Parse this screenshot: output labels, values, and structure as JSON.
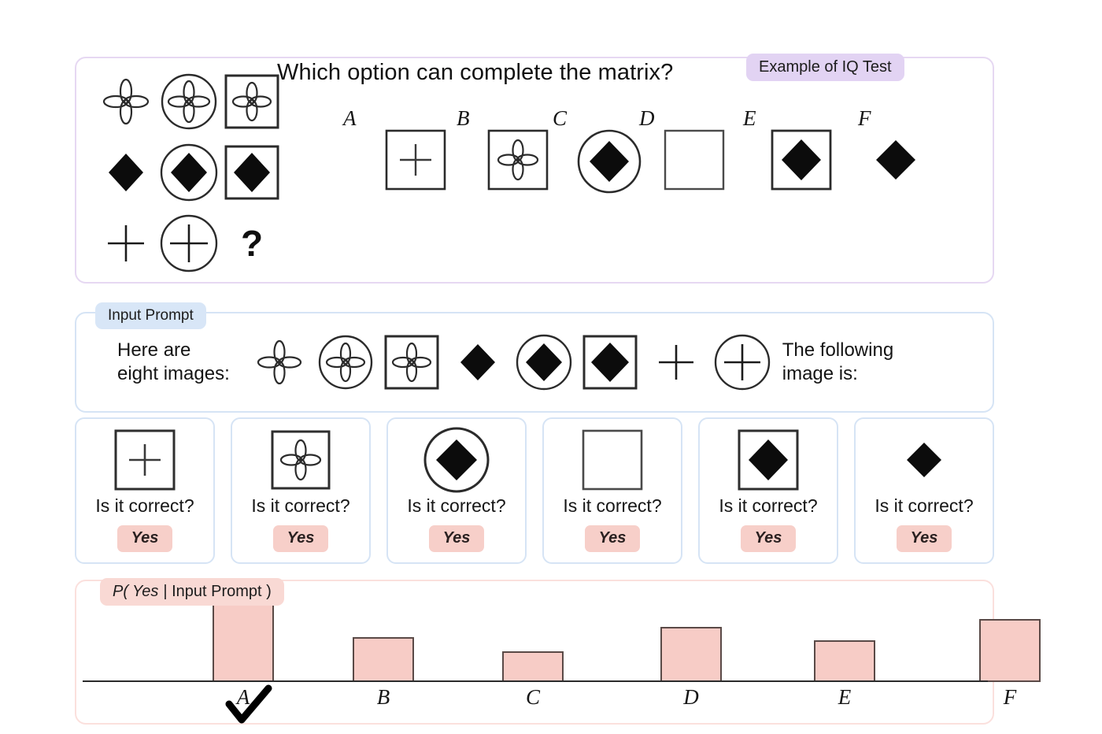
{
  "iq_panel": {
    "badge": "Example of IQ Test",
    "question": "Which option can complete the matrix?",
    "matrix_rows": [
      [
        "flower",
        "circle-flower",
        "square-flower"
      ],
      [
        "diamond",
        "circle-diamond",
        "square-diamond"
      ],
      [
        "plus",
        "circle-plus",
        "question-mark"
      ]
    ],
    "missing_cell": "?",
    "options": [
      {
        "label": "A",
        "shape": "square-plus"
      },
      {
        "label": "B",
        "shape": "square-flower"
      },
      {
        "label": "C",
        "shape": "circle-diamond"
      },
      {
        "label": "D",
        "shape": "square-empty"
      },
      {
        "label": "E",
        "shape": "square-diamond"
      },
      {
        "label": "F",
        "shape": "diamond"
      }
    ]
  },
  "prompt_panel": {
    "badge": "Input Prompt",
    "lead_text": "Here are\neight images:",
    "tail_text": "The following\nimage is:",
    "images": [
      "flower",
      "circle-flower",
      "square-flower",
      "diamond",
      "circle-diamond",
      "square-diamond",
      "plus",
      "circle-plus"
    ]
  },
  "candidates": [
    {
      "label": "A",
      "shape": "square-plus",
      "question": "Is it correct?",
      "answer": "Yes"
    },
    {
      "label": "B",
      "shape": "square-flower",
      "question": "Is it correct?",
      "answer": "Yes"
    },
    {
      "label": "C",
      "shape": "circle-diamond",
      "question": "Is it correct?",
      "answer": "Yes"
    },
    {
      "label": "D",
      "shape": "square-empty",
      "question": "Is it correct?",
      "answer": "Yes"
    },
    {
      "label": "E",
      "shape": "square-diamond",
      "question": "Is it correct?",
      "answer": "Yes"
    },
    {
      "label": "F",
      "shape": "diamond",
      "question": "Is it correct?",
      "answer": "Yes"
    }
  ],
  "histogram": {
    "badge_prefix": "P(",
    "badge_italic": "Yes",
    "badge_suffix": "| Input Prompt )",
    "selected": "A"
  },
  "colors": {
    "purple_border": "#e6d8f2",
    "purple_badge": "#e2d3f3",
    "blue_border": "#d6e4f5",
    "blue_badge": "#d8e6f7",
    "pink_border": "#fbe0dd",
    "pink_badge": "#f9d9d4",
    "bar_fill": "#f7ccc6",
    "bar_stroke": "#5a4a47",
    "yes_badge": "#f7cfc9",
    "ink": "#1c1c1c"
  },
  "chart_data": {
    "type": "bar",
    "title": "P( Yes | Input Prompt )",
    "categories": [
      "A",
      "B",
      "C",
      "D",
      "E",
      "F"
    ],
    "values": [
      1.0,
      0.5,
      0.34,
      0.61,
      0.46,
      0.7
    ],
    "xlabel": "",
    "ylabel": "",
    "ylim": [
      0,
      1.05
    ],
    "grid": false,
    "legend": "none",
    "highlight": "A",
    "annotations": [
      {
        "category": "A",
        "marker": "check"
      }
    ]
  }
}
